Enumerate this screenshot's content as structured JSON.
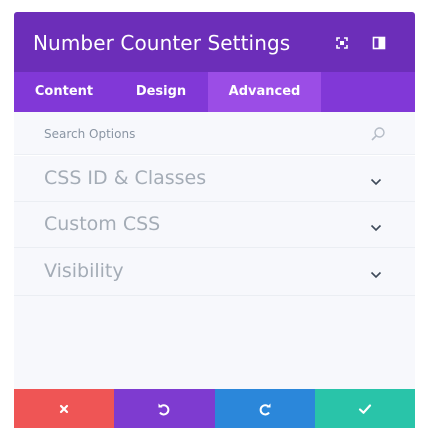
{
  "header": {
    "title": "Number Counter Settings",
    "icons": [
      "expand-icon",
      "sidebar-dock-icon"
    ]
  },
  "tabs": [
    {
      "label": "Content",
      "active": false
    },
    {
      "label": "Design",
      "active": false
    },
    {
      "label": "Advanced",
      "active": true
    }
  ],
  "search": {
    "placeholder": "Search Options",
    "icon": "search-icon"
  },
  "sections": [
    {
      "label": "CSS ID & Classes",
      "icon": "chevron-down-icon"
    },
    {
      "label": "Custom CSS",
      "icon": "chevron-down-icon"
    },
    {
      "label": "Visibility",
      "icon": "chevron-down-icon"
    }
  ],
  "footer": {
    "buttons": [
      {
        "name": "discard",
        "icon": "close-icon",
        "color": "#ef5555"
      },
      {
        "name": "undo",
        "icon": "undo-icon",
        "color": "#7e3bd0"
      },
      {
        "name": "redo",
        "icon": "redo-icon",
        "color": "#2b87da"
      },
      {
        "name": "save",
        "icon": "check-icon",
        "color": "#29c4a9"
      }
    ]
  },
  "colors": {
    "header_bg": "#6c2eb9",
    "tabs_bg": "#8138d7",
    "active_tab_bg": "#9b4de6",
    "panel_bg": "#f7f8fc"
  }
}
